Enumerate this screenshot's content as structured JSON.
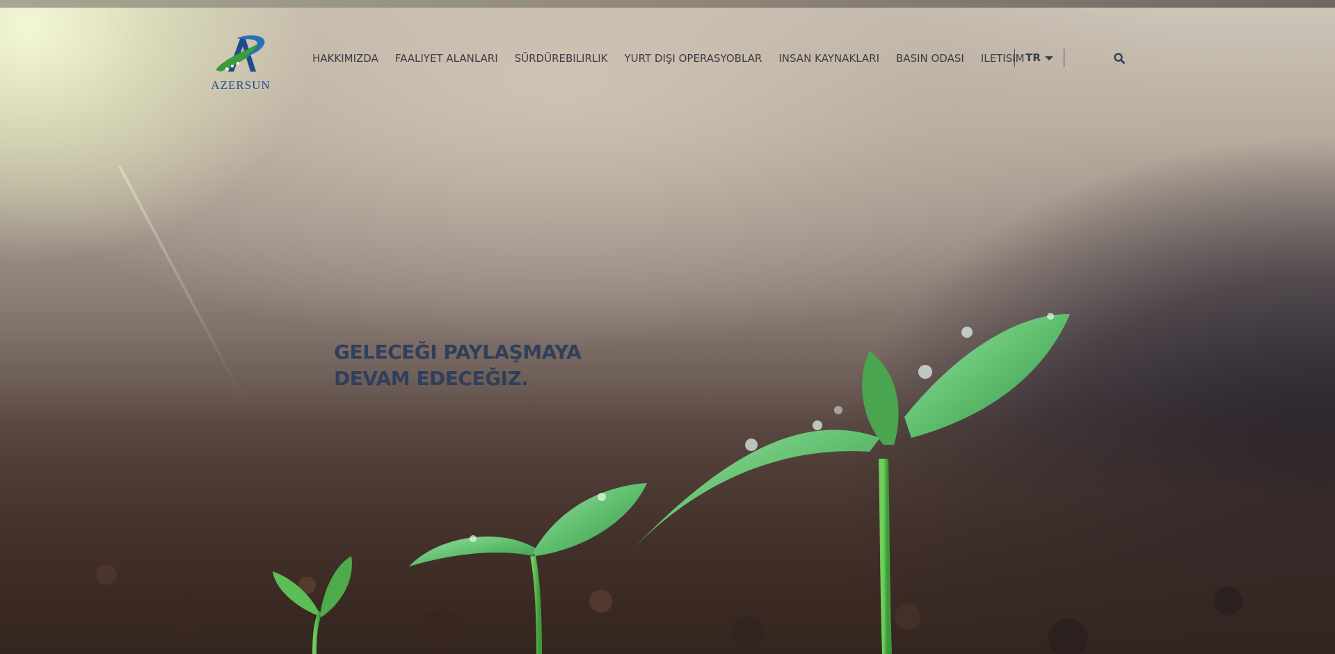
{
  "header": {
    "logo": {
      "name": "AZERSUN",
      "icon": "azersun-logo-icon"
    },
    "nav": [
      {
        "label": "HAKKIMIZDA"
      },
      {
        "label": "FAALIYET ALANLARI"
      },
      {
        "label": "SÜRDÜREBILIRLIK"
      },
      {
        "label": "YURT DIŞI OPERASYOBLAR"
      },
      {
        "label": "INSAN KAYNAKLARI"
      },
      {
        "label": "BASIN ODASI"
      },
      {
        "label": "ILETISIM"
      }
    ],
    "language": {
      "selected": "TR",
      "icon": "chevron-down-icon"
    },
    "search": {
      "icon": "search-icon"
    }
  },
  "hero": {
    "title_line1": "GELECEĞI PAYLAŞMAYA",
    "title_line2": "DEVAM EDECEĞIZ.",
    "image": "sprouts-in-soil-photo"
  },
  "colors": {
    "nav_text": "#3b3d44",
    "hero_title": "#2f3f5c",
    "logo_blue": "#1f4c8f",
    "logo_green": "#3d9b3a"
  }
}
